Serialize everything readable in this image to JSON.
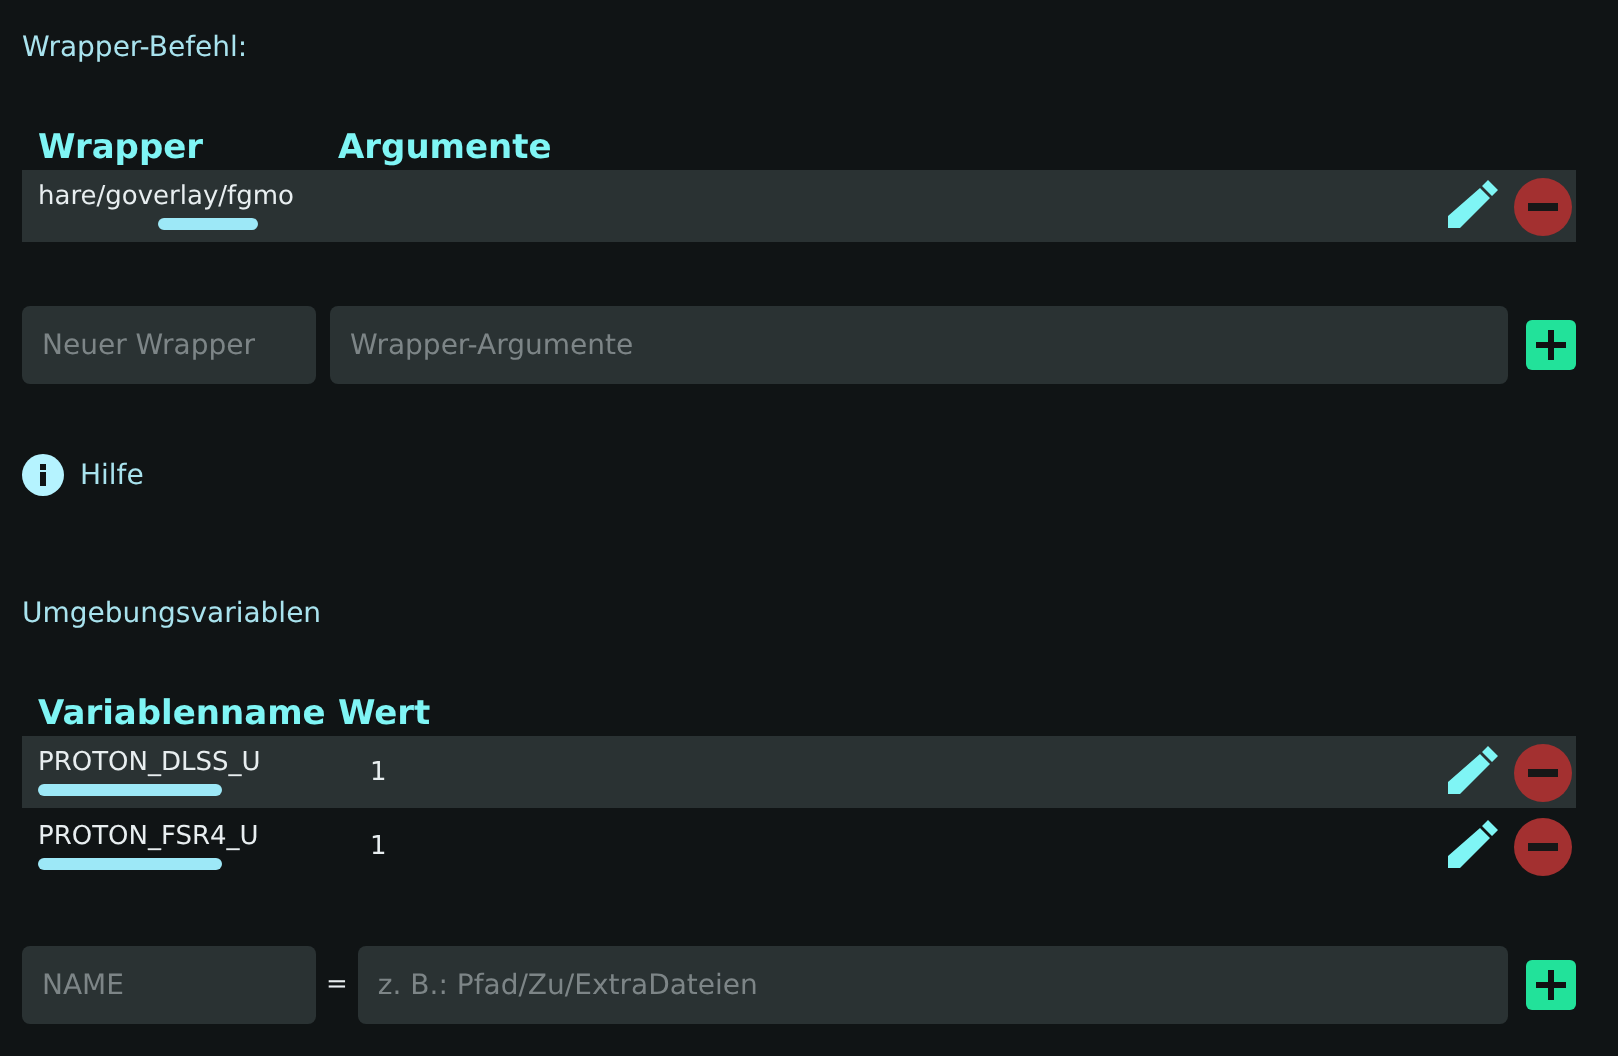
{
  "wrapper_section": {
    "label": "Wrapper-Befehl:",
    "columns": [
      "Wrapper",
      "Argumente"
    ],
    "rows": [
      {
        "cells": [
          "hare/goverlay/fgmo"
        ],
        "selected": true
      }
    ],
    "form": {
      "fields": [
        {
          "placeholder": "Neuer Wrapper"
        },
        {
          "placeholder": "Wrapper-Argumente"
        }
      ]
    }
  },
  "help": {
    "label": "Hilfe"
  },
  "env_section": {
    "label": "Umgebungsvariablen",
    "columns": [
      "Variablenname",
      "Wert"
    ],
    "rows": [
      {
        "cells": [
          "PROTON_DLSS_U",
          "1"
        ],
        "selected": true
      },
      {
        "cells": [
          "PROTON_FSR4_U",
          "1"
        ],
        "selected": false
      }
    ],
    "form": {
      "separator": "=",
      "fields": [
        {
          "placeholder": "NAME"
        },
        {
          "placeholder": "z. B.: Pfad/Zu/ExtraDateien"
        }
      ]
    }
  }
}
